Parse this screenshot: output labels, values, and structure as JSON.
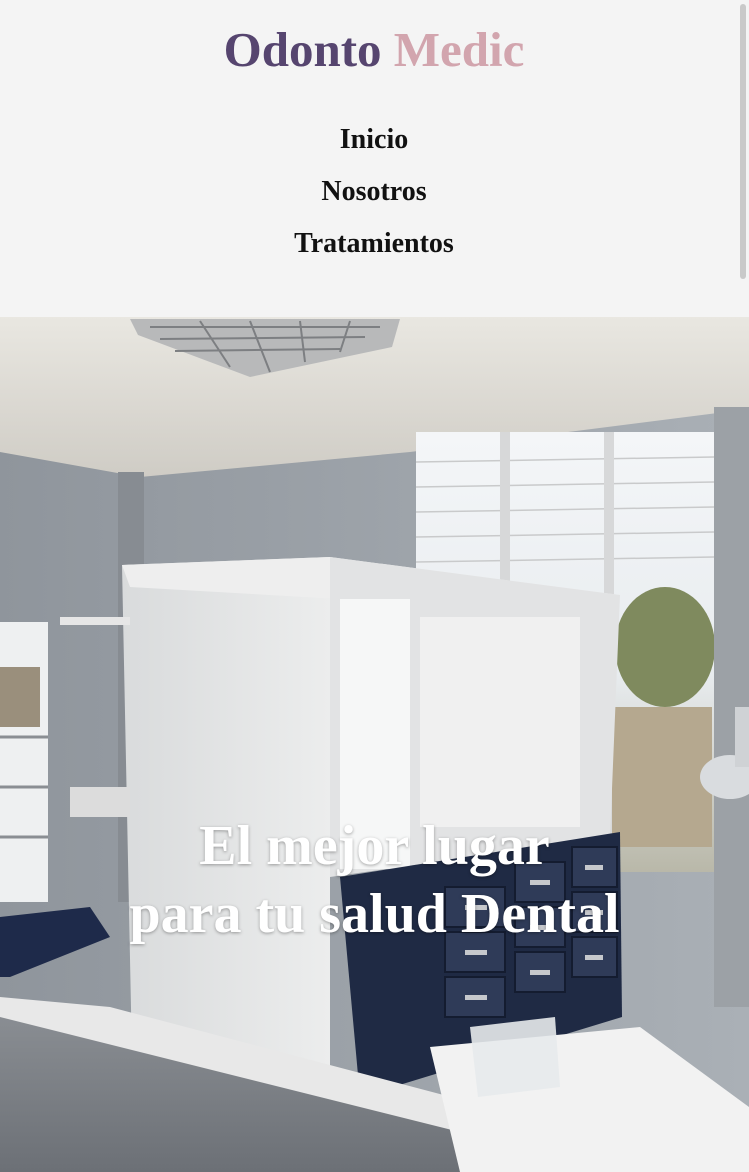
{
  "brand": {
    "name_part1": "Odonto",
    "name_part2": "Medic",
    "color_part1": "#56456f",
    "color_part2": "#d2a5ae"
  },
  "nav": {
    "items": [
      {
        "label": "Inicio"
      },
      {
        "label": "Nosotros"
      },
      {
        "label": "Tratamientos"
      }
    ]
  },
  "hero": {
    "image": "dental-office-photo",
    "headline_line1": "El mejor lugar",
    "headline_line2": "para tu salud Dental"
  }
}
